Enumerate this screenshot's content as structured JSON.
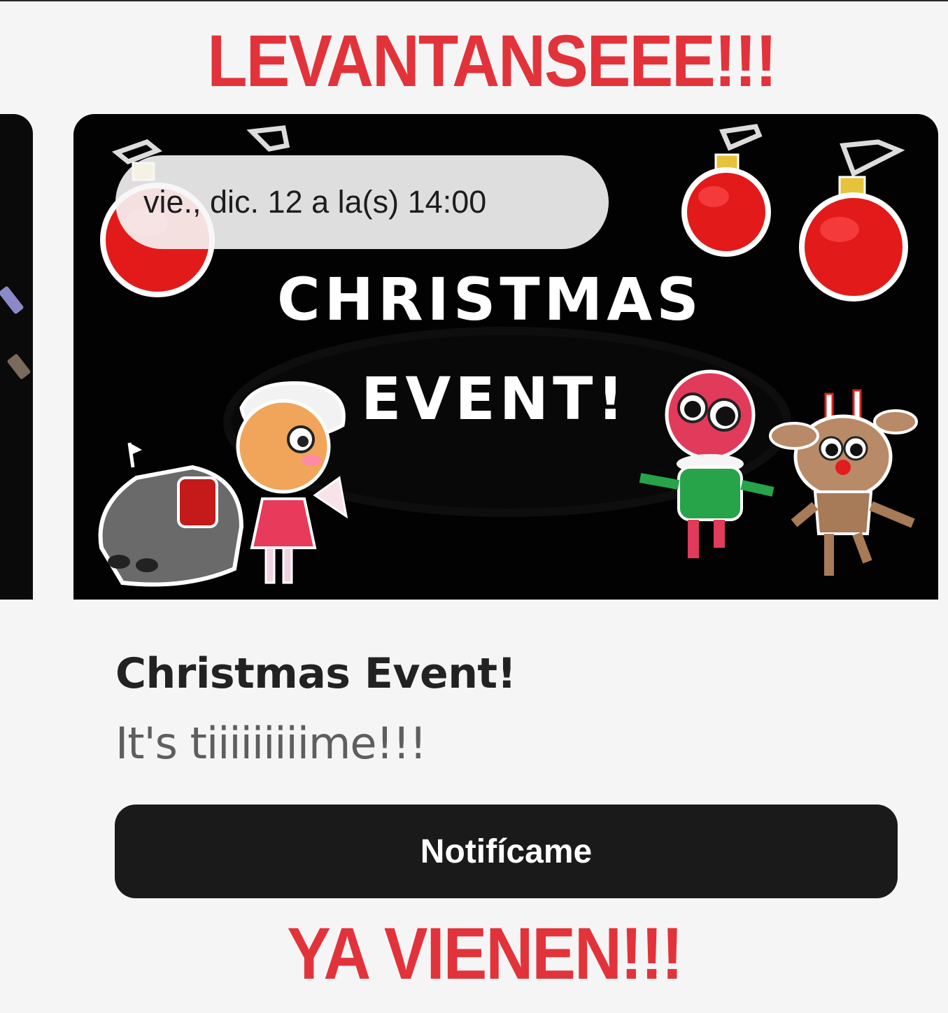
{
  "captions": {
    "top": "LEVANTANSEEE!!!",
    "bottom": "YA VIENEN!!!"
  },
  "event": {
    "date_label": "vie., dic. 12 a la(s) 14:00",
    "banner_title_line1": "CHRISTMAS",
    "banner_title_line2": "EVENT!",
    "title": "Christmas Event!",
    "description": "It's tiiiiiiiiime!!!",
    "notify_label": "Notifícame"
  },
  "colors": {
    "caption": "#e2333b",
    "button": "#1a1a1b",
    "ornament": "#e21d1d",
    "background": "#f5f5f6"
  }
}
